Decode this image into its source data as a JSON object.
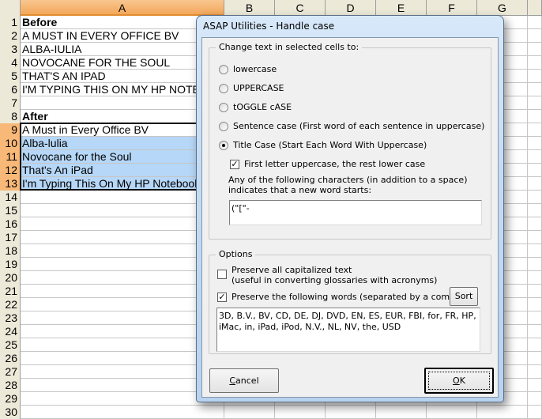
{
  "spreadsheet": {
    "columns": [
      "A",
      "B",
      "C",
      "D",
      "E",
      "F",
      "G"
    ],
    "selected_column": "A",
    "rows": [
      {
        "num": "1",
        "a": "Before",
        "bold": true,
        "hl": false,
        "sel": false
      },
      {
        "num": "2",
        "a": "A MUST IN EVERY OFFICE BV",
        "bold": false,
        "hl": false,
        "sel": false
      },
      {
        "num": "3",
        "a": "ALBA-IULIA",
        "bold": false,
        "hl": false,
        "sel": false
      },
      {
        "num": "4",
        "a": "NOVOCANE FOR THE SOUL",
        "bold": false,
        "hl": false,
        "sel": false
      },
      {
        "num": "5",
        "a": "THAT'S AN IPAD",
        "bold": false,
        "hl": false,
        "sel": false
      },
      {
        "num": "6",
        "a": "I'M TYPING THIS ON MY HP NOTEBOOK",
        "bold": false,
        "hl": false,
        "sel": false
      },
      {
        "num": "7",
        "a": "",
        "bold": false,
        "hl": false,
        "sel": false
      },
      {
        "num": "8",
        "a": "After",
        "bold": true,
        "hl": false,
        "sel": false
      },
      {
        "num": "9",
        "a": "A Must in Every Office BV",
        "bold": false,
        "hl": false,
        "sel": true
      },
      {
        "num": "10",
        "a": "Alba-lulia",
        "bold": false,
        "hl": true,
        "sel": true
      },
      {
        "num": "11",
        "a": "Novocane for the Soul",
        "bold": false,
        "hl": true,
        "sel": true
      },
      {
        "num": "12",
        "a": "That's An iPad",
        "bold": false,
        "hl": true,
        "sel": true
      },
      {
        "num": "13",
        "a": "I'm Typing This On My HP Notebook",
        "bold": false,
        "hl": true,
        "sel": true
      },
      {
        "num": "14",
        "a": "",
        "bold": false,
        "hl": false,
        "sel": false
      },
      {
        "num": "15",
        "a": "",
        "bold": false,
        "hl": false,
        "sel": false
      },
      {
        "num": "16",
        "a": "",
        "bold": false,
        "hl": false,
        "sel": false
      },
      {
        "num": "17",
        "a": "",
        "bold": false,
        "hl": false,
        "sel": false
      },
      {
        "num": "18",
        "a": "",
        "bold": false,
        "hl": false,
        "sel": false
      },
      {
        "num": "19",
        "a": "",
        "bold": false,
        "hl": false,
        "sel": false
      },
      {
        "num": "20",
        "a": "",
        "bold": false,
        "hl": false,
        "sel": false
      },
      {
        "num": "21",
        "a": "",
        "bold": false,
        "hl": false,
        "sel": false
      },
      {
        "num": "22",
        "a": "",
        "bold": false,
        "hl": false,
        "sel": false
      },
      {
        "num": "23",
        "a": "",
        "bold": false,
        "hl": false,
        "sel": false
      },
      {
        "num": "24",
        "a": "",
        "bold": false,
        "hl": false,
        "sel": false
      },
      {
        "num": "25",
        "a": "",
        "bold": false,
        "hl": false,
        "sel": false
      },
      {
        "num": "26",
        "a": "",
        "bold": false,
        "hl": false,
        "sel": false
      },
      {
        "num": "27",
        "a": "",
        "bold": false,
        "hl": false,
        "sel": false
      },
      {
        "num": "28",
        "a": "",
        "bold": false,
        "hl": false,
        "sel": false
      },
      {
        "num": "29",
        "a": "",
        "bold": false,
        "hl": false,
        "sel": false
      },
      {
        "num": "30",
        "a": "",
        "bold": false,
        "hl": false,
        "sel": false
      }
    ]
  },
  "dialog": {
    "title": "ASAP Utilities - Handle case",
    "change_group": {
      "legend": "Change text in selected cells to:",
      "options": [
        {
          "label": "lowercase",
          "selected": false
        },
        {
          "label": "UPPERCASE",
          "selected": false
        },
        {
          "label": "tOGGLE cASE",
          "selected": false
        },
        {
          "label": "Sentence case (First word of each sentence in uppercase)",
          "selected": false
        },
        {
          "label": "Title Case (Start Each Word With Uppercase)",
          "selected": true
        }
      ],
      "first_letter_checkbox": {
        "label": "First letter uppercase, the rest lower case",
        "checked": true
      },
      "separators_description": "Any of the following characters (in addition to a space) indicates that a new word starts:",
      "separators_value": "(\"[\"-"
    },
    "options_group": {
      "legend": "Options",
      "preserve_caps": {
        "label_line1": "Preserve all capitalized text",
        "label_line2": "(useful in converting glossaries with acronyms)",
        "checked": false
      },
      "preserve_words": {
        "label": "Preserve the following words (separated by a comma):",
        "checked": true
      },
      "sort_button": "Sort",
      "words_value": "3D, B.V., BV, CD, DE, DJ, DVD, EN, ES, EUR, FBI, for, FR, HP, iMac, in, iPad, iPod, N.V., NL, NV, the, USD"
    },
    "buttons": {
      "cancel_prefix": "C",
      "cancel_rest": "ancel",
      "ok_prefix": "O",
      "ok_rest": "K"
    }
  }
}
